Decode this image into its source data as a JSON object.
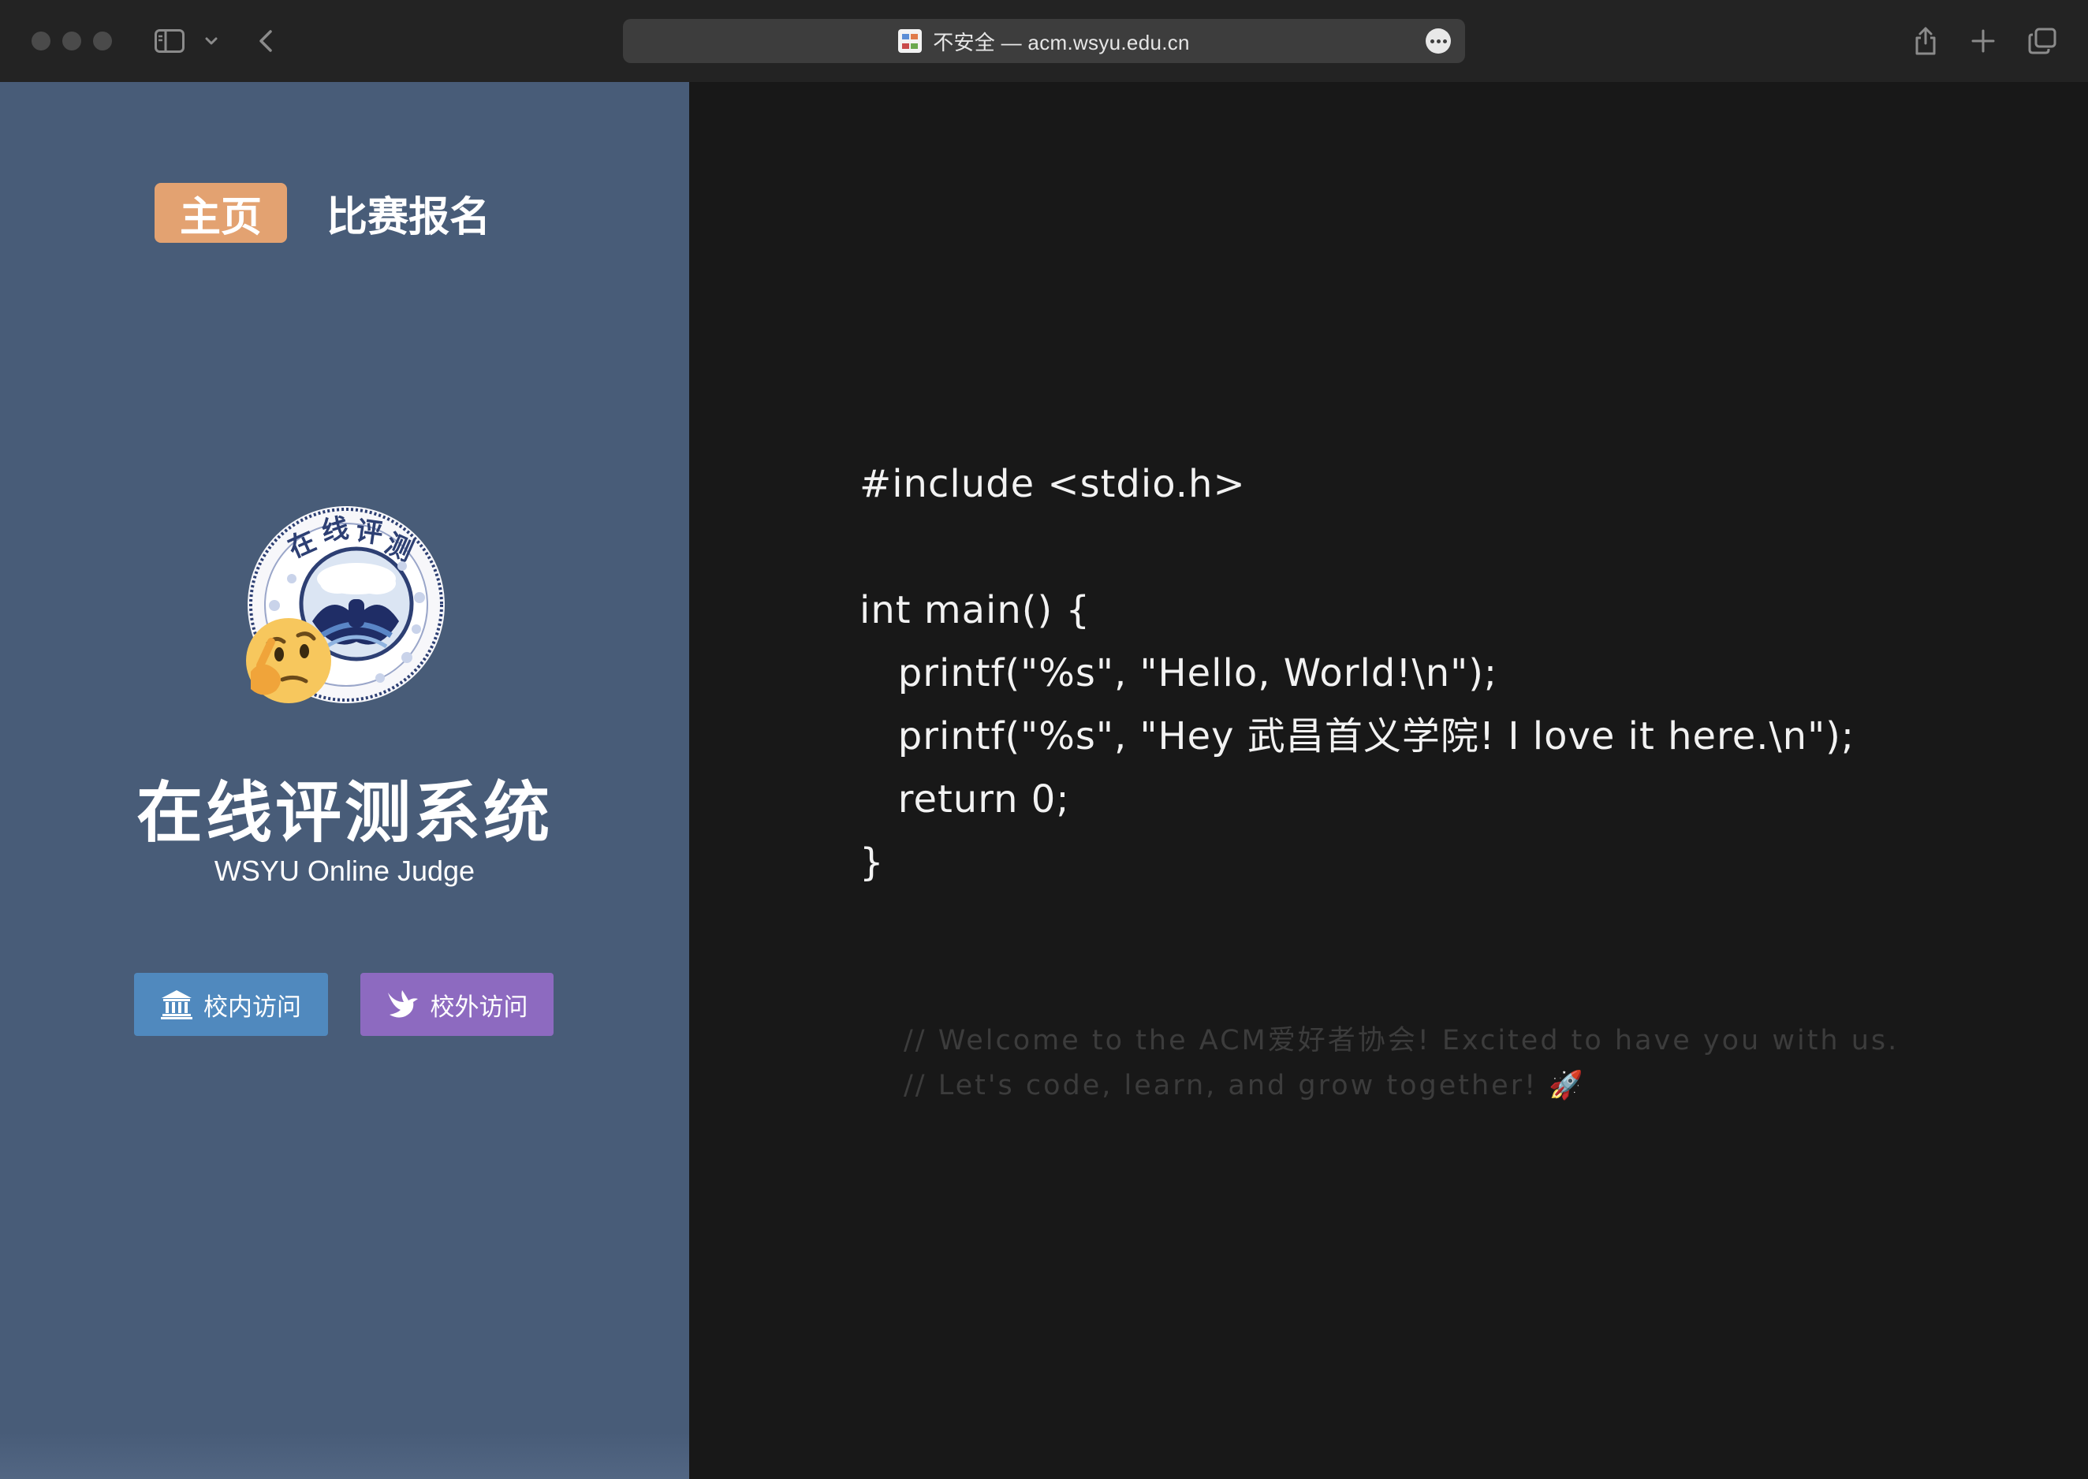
{
  "browser": {
    "address_bar_text": "不安全 — acm.wsyu.edu.cn"
  },
  "nav": {
    "items": [
      {
        "label": "主页",
        "active": true
      },
      {
        "label": "比赛报名",
        "active": false
      }
    ]
  },
  "hero": {
    "logo_text": "在线评测",
    "title": "在线评测系统",
    "subtitle": "WSYU Online Judge"
  },
  "actions": {
    "campus_label": "校内访问",
    "external_label": "校外访问"
  },
  "code": {
    "lines": [
      "#include <stdio.h>",
      "",
      "int main() {",
      "   printf(\"%s\", \"Hello, World!\\n\");",
      "   printf(\"%s\", \"Hey 武昌首义学院! I love it here.\\n\");",
      "   return 0;",
      "}"
    ],
    "comments": [
      "// Welcome to the ACM爱好者协会! Excited to have you with us.",
      "// Let's code, learn, and grow together! 🚀"
    ]
  },
  "colors": {
    "sidebar_bg": "#485c78",
    "accent_home": "#e3a271",
    "campus_button": "#5089be",
    "external_button": "#8d6ac0",
    "code_bg": "#181818"
  },
  "icons": {
    "campus": "institution-icon",
    "external": "bird-icon",
    "mascot": "thinking-face-icon"
  }
}
